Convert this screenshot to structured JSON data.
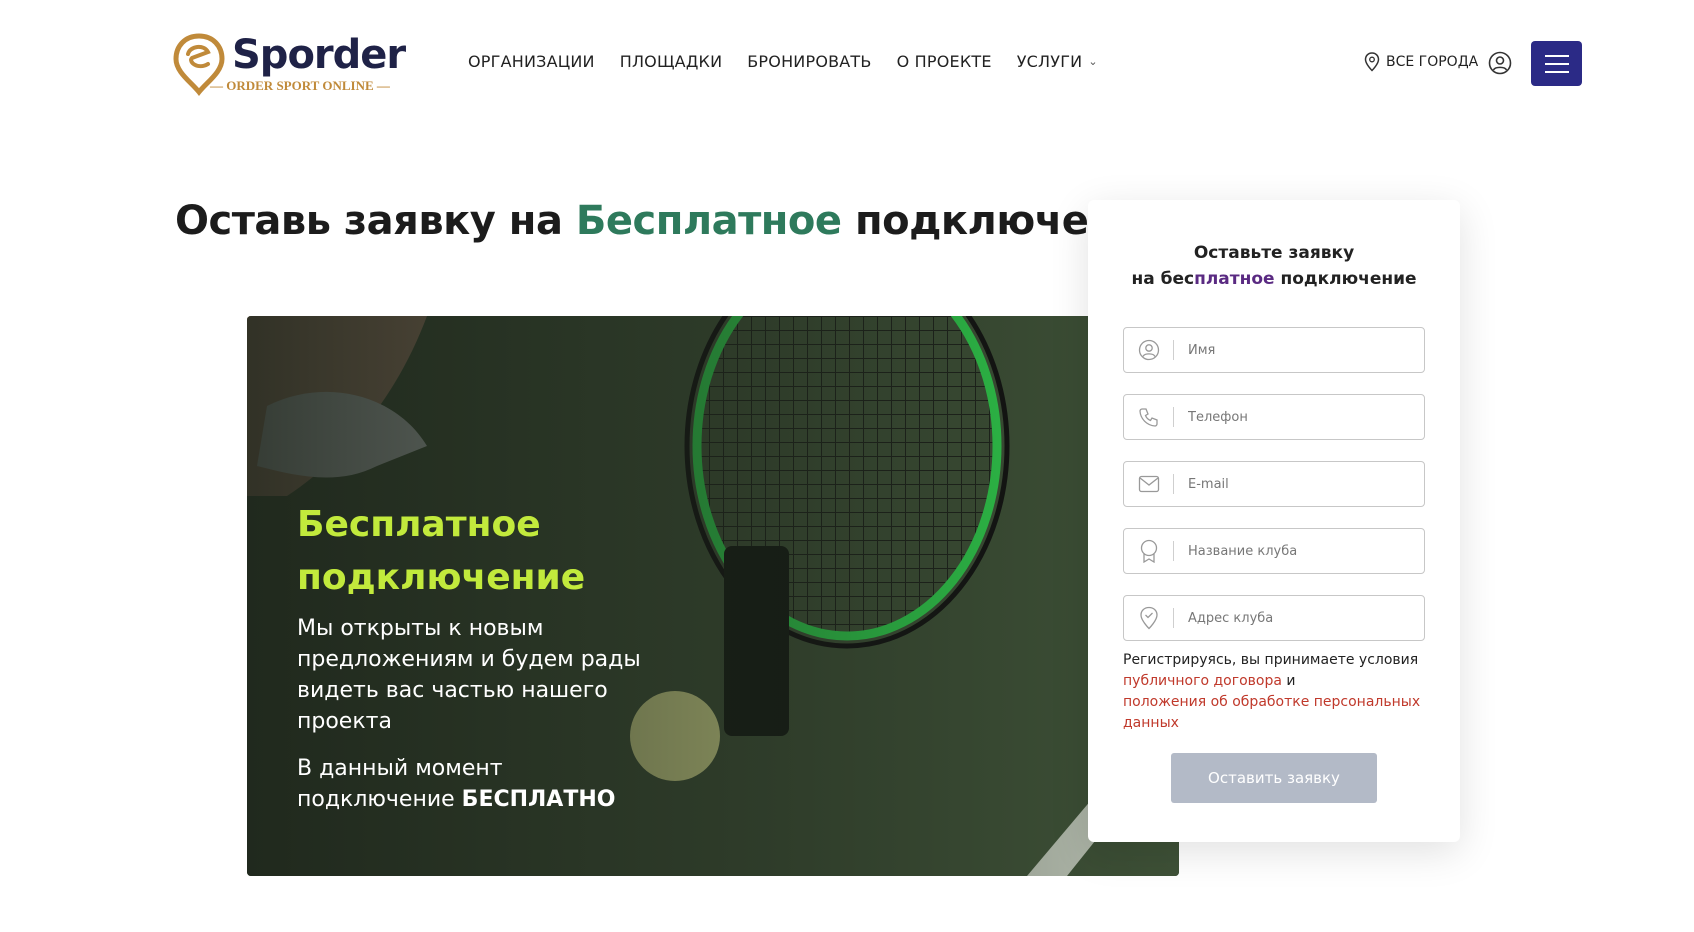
{
  "header": {
    "logo": {
      "brand": "Sporder",
      "tagline": "— ORDER SPORT ONLINE —"
    },
    "nav": [
      {
        "label": "ОРГАНИЗАЦИИ"
      },
      {
        "label": "ПЛОЩАДКИ"
      },
      {
        "label": "БРОНИРОВАТЬ"
      },
      {
        "label": "О ПРОЕКТЕ"
      },
      {
        "label": "УСЛУГИ"
      }
    ],
    "city": "ВСЕ ГОРОДА"
  },
  "heading": {
    "before": "Оставь заявку на ",
    "accent": "Бесплатное",
    "after": " подключение"
  },
  "banner": {
    "title": "Бесплатное подключение",
    "text": "Мы открыты к новым предложениям и будем рады видеть вас частью нашего проекта",
    "text2_prefix": "В данный момент подключение ",
    "text2_bold": "БЕСПЛАТНО"
  },
  "form": {
    "title_line1": "Оставьте заявку",
    "title_line2_prefix": "на бес",
    "title_line2_accent": "платное",
    "title_line2_suffix": " подключение",
    "fields": [
      {
        "placeholder": "Имя",
        "icon": "user-icon"
      },
      {
        "placeholder": "Телефон",
        "icon": "phone-icon"
      },
      {
        "placeholder": "E-mail",
        "icon": "mail-icon"
      },
      {
        "placeholder": "Название клуба",
        "icon": "award-icon"
      },
      {
        "placeholder": "Адрес клуба",
        "icon": "location-icon"
      }
    ],
    "terms_text": "Регистрируясь, вы принимаете условия",
    "terms_link1": "публичного договора",
    "terms_and": " и",
    "terms_link2": "положения об обработке персональных данных",
    "submit_label": "Оставить заявку"
  },
  "colors": {
    "brand_dark": "#1f2247",
    "brand_gold": "#c08a3a",
    "accent_green": "#2e7a5c",
    "banner_title": "#c2ea3c",
    "burger_bg": "#2b2a86",
    "link_red": "#c0392b",
    "button_bg": "#b3bac7"
  }
}
